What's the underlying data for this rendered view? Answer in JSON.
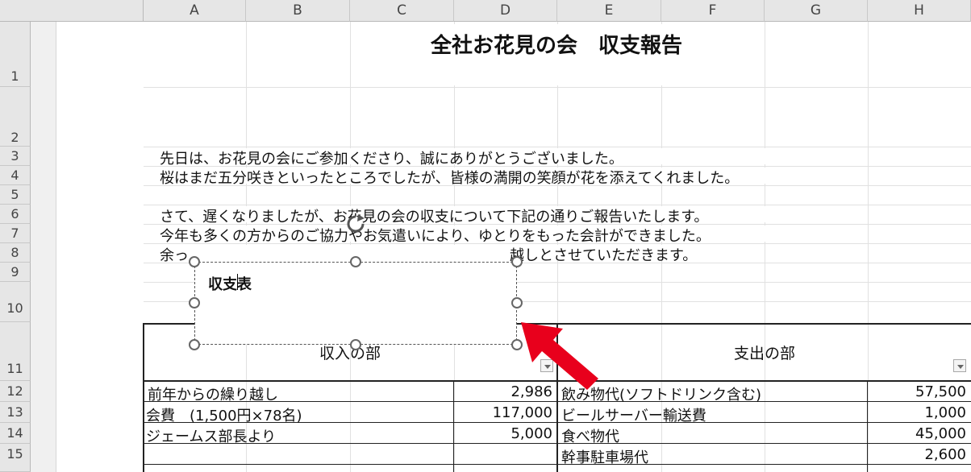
{
  "columns": [
    "A",
    "B",
    "C",
    "D",
    "E",
    "F",
    "G",
    "H"
  ],
  "rows": [
    "1",
    "2",
    "3",
    "4",
    "5",
    "6",
    "7",
    "8",
    "9",
    "10",
    "11",
    "12",
    "13",
    "14",
    "15"
  ],
  "title": "全社お花見の会　収支報告",
  "paragraphs": {
    "r3": "先日は、お花見の会にご参加くださり、誠にありがとうございました。",
    "r4": "桜はまだ五分咲きといったところでしたが、皆様の満開の笑顔が花を添えてくれました。",
    "r6": "さて、遅くなりましたが、お花見の会の収支について下記の通りご報告いたします。",
    "r7": "今年も多くの方からのご協力やお気遣いにより、ゆとりをもった会計ができました。",
    "r8_start": "余っ",
    "r8_end": "越しとさせていただきます。"
  },
  "textbox": {
    "text": "収支表"
  },
  "table": {
    "income_header": "収入の部",
    "expense_header": "支出の部",
    "income": [
      {
        "label": "前年からの繰り越し",
        "amount": "2,986"
      },
      {
        "label": "会費　(1,500円×78名)",
        "amount": "117,000"
      },
      {
        "label": "ジェームス部長より",
        "amount": "5,000"
      }
    ],
    "expense": [
      {
        "label": "飲み物代(ソフトドリンク含む)",
        "amount": "57,500"
      },
      {
        "label": "ビールサーバー輸送費",
        "amount": "1,000"
      },
      {
        "label": "食べ物代",
        "amount": "45,000"
      },
      {
        "label": "幹事駐車場代",
        "amount": "2,600"
      }
    ]
  },
  "colors": {
    "arrow": "#e8001c",
    "grid": "#e1e1e1",
    "header": "#e6e6e6"
  },
  "icons": [
    "rotate-handle-icon",
    "dropdown-arrow-icon",
    "red-arrow-icon"
  ]
}
